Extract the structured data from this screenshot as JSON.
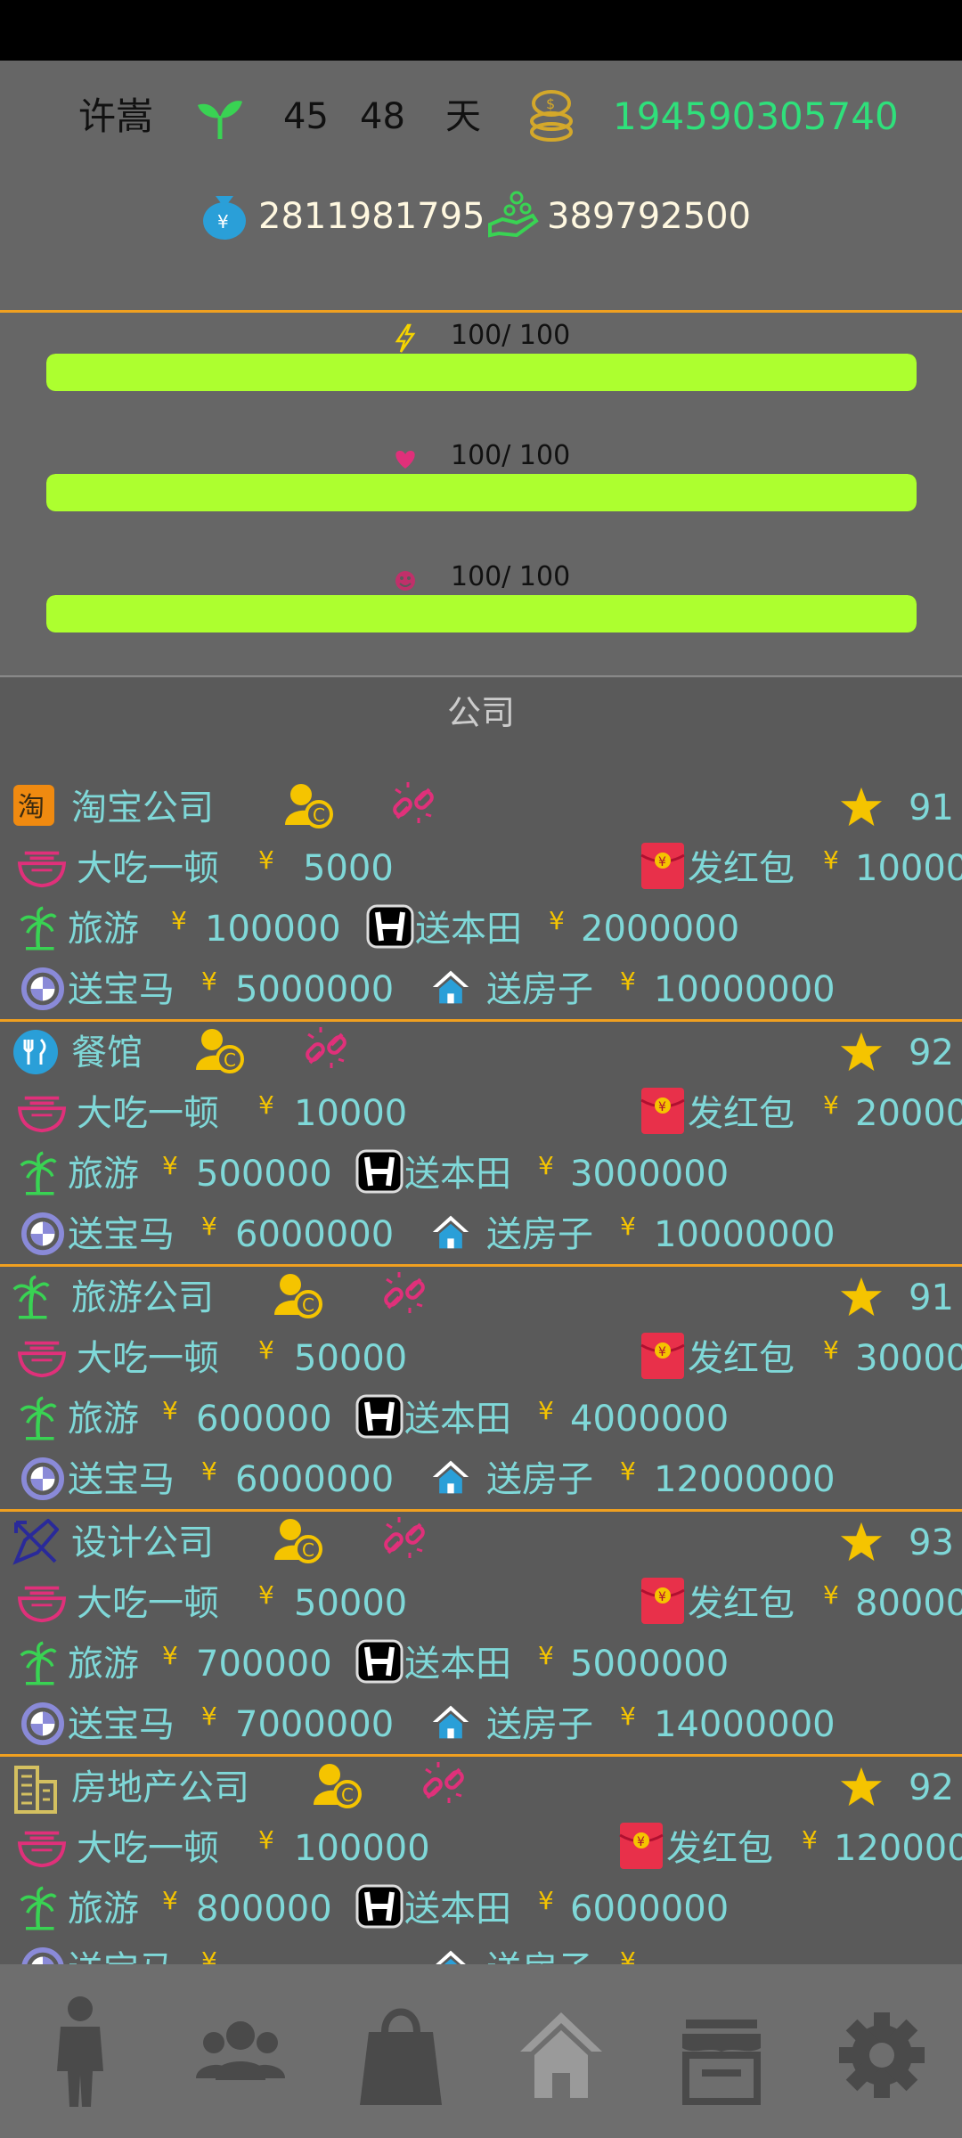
{
  "header": {
    "name": "许嵩",
    "age_a": "45",
    "age_b": "48",
    "day_label": "天",
    "money": "194590305740",
    "assets": "2811981795",
    "income": "389792500"
  },
  "stats": [
    {
      "icon": "energy-icon",
      "text": "100/ 100",
      "value": 100,
      "max": 100
    },
    {
      "icon": "heart-icon",
      "text": "100/ 100",
      "value": 100,
      "max": 100
    },
    {
      "icon": "happiness-icon",
      "text": "100/ 100",
      "value": 100,
      "max": 100
    }
  ],
  "section_title": "公司",
  "companies": [
    {
      "icon": "taobao-icon",
      "name": "淘宝公司",
      "rating": "91",
      "dinner_label": "大吃一顿",
      "dinner_cost": "5000",
      "redpacket_label": "发红包",
      "redpacket_cost": "10000",
      "travel_label": "旅游",
      "travel_cost": "100000",
      "honda_label": "送本田",
      "honda_cost": "2000000",
      "bmw_label": "送宝马",
      "bmw_cost": "5000000",
      "house_label": "送房子",
      "house_cost": "10000000"
    },
    {
      "icon": "restaurant-icon",
      "name": "餐馆",
      "rating": "92",
      "dinner_label": "大吃一顿",
      "dinner_cost": "10000",
      "redpacket_label": "发红包",
      "redpacket_cost": "20000",
      "travel_label": "旅游",
      "travel_cost": "500000",
      "honda_label": "送本田",
      "honda_cost": "3000000",
      "bmw_label": "送宝马",
      "bmw_cost": "6000000",
      "house_label": "送房子",
      "house_cost": "10000000"
    },
    {
      "icon": "palm-icon",
      "name": "旅游公司",
      "rating": "91",
      "dinner_label": "大吃一顿",
      "dinner_cost": "50000",
      "redpacket_label": "发红包",
      "redpacket_cost": "30000",
      "travel_label": "旅游",
      "travel_cost": "600000",
      "honda_label": "送本田",
      "honda_cost": "4000000",
      "bmw_label": "送宝马",
      "bmw_cost": "6000000",
      "house_label": "送房子",
      "house_cost": "12000000"
    },
    {
      "icon": "design-icon",
      "name": "设计公司",
      "rating": "93",
      "dinner_label": "大吃一顿",
      "dinner_cost": "50000",
      "redpacket_label": "发红包",
      "redpacket_cost": "80000",
      "travel_label": "旅游",
      "travel_cost": "700000",
      "honda_label": "送本田",
      "honda_cost": "5000000",
      "bmw_label": "送宝马",
      "bmw_cost": "7000000",
      "house_label": "送房子",
      "house_cost": "14000000"
    },
    {
      "icon": "building-icon",
      "name": "房地产公司",
      "rating": "92",
      "dinner_label": "大吃一顿",
      "dinner_cost": "100000",
      "redpacket_label": "发红包",
      "redpacket_cost": "120000",
      "travel_label": "旅游",
      "travel_cost": "800000",
      "honda_label": "送本田",
      "honda_cost": "6000000",
      "bmw_label": "送宝马",
      "bmw_cost": "",
      "house_label": "送房子",
      "house_cost": ""
    }
  ],
  "colors": {
    "accent": "#f0a020",
    "bar": "#adff2f",
    "money": "#2fe07b",
    "text": "#7fd8d8",
    "yen": "#f5c400",
    "pink": "#e0307a"
  },
  "nav": [
    "person-icon",
    "people-icon",
    "bag-icon",
    "home-icon",
    "shop-icon",
    "gear-icon"
  ]
}
